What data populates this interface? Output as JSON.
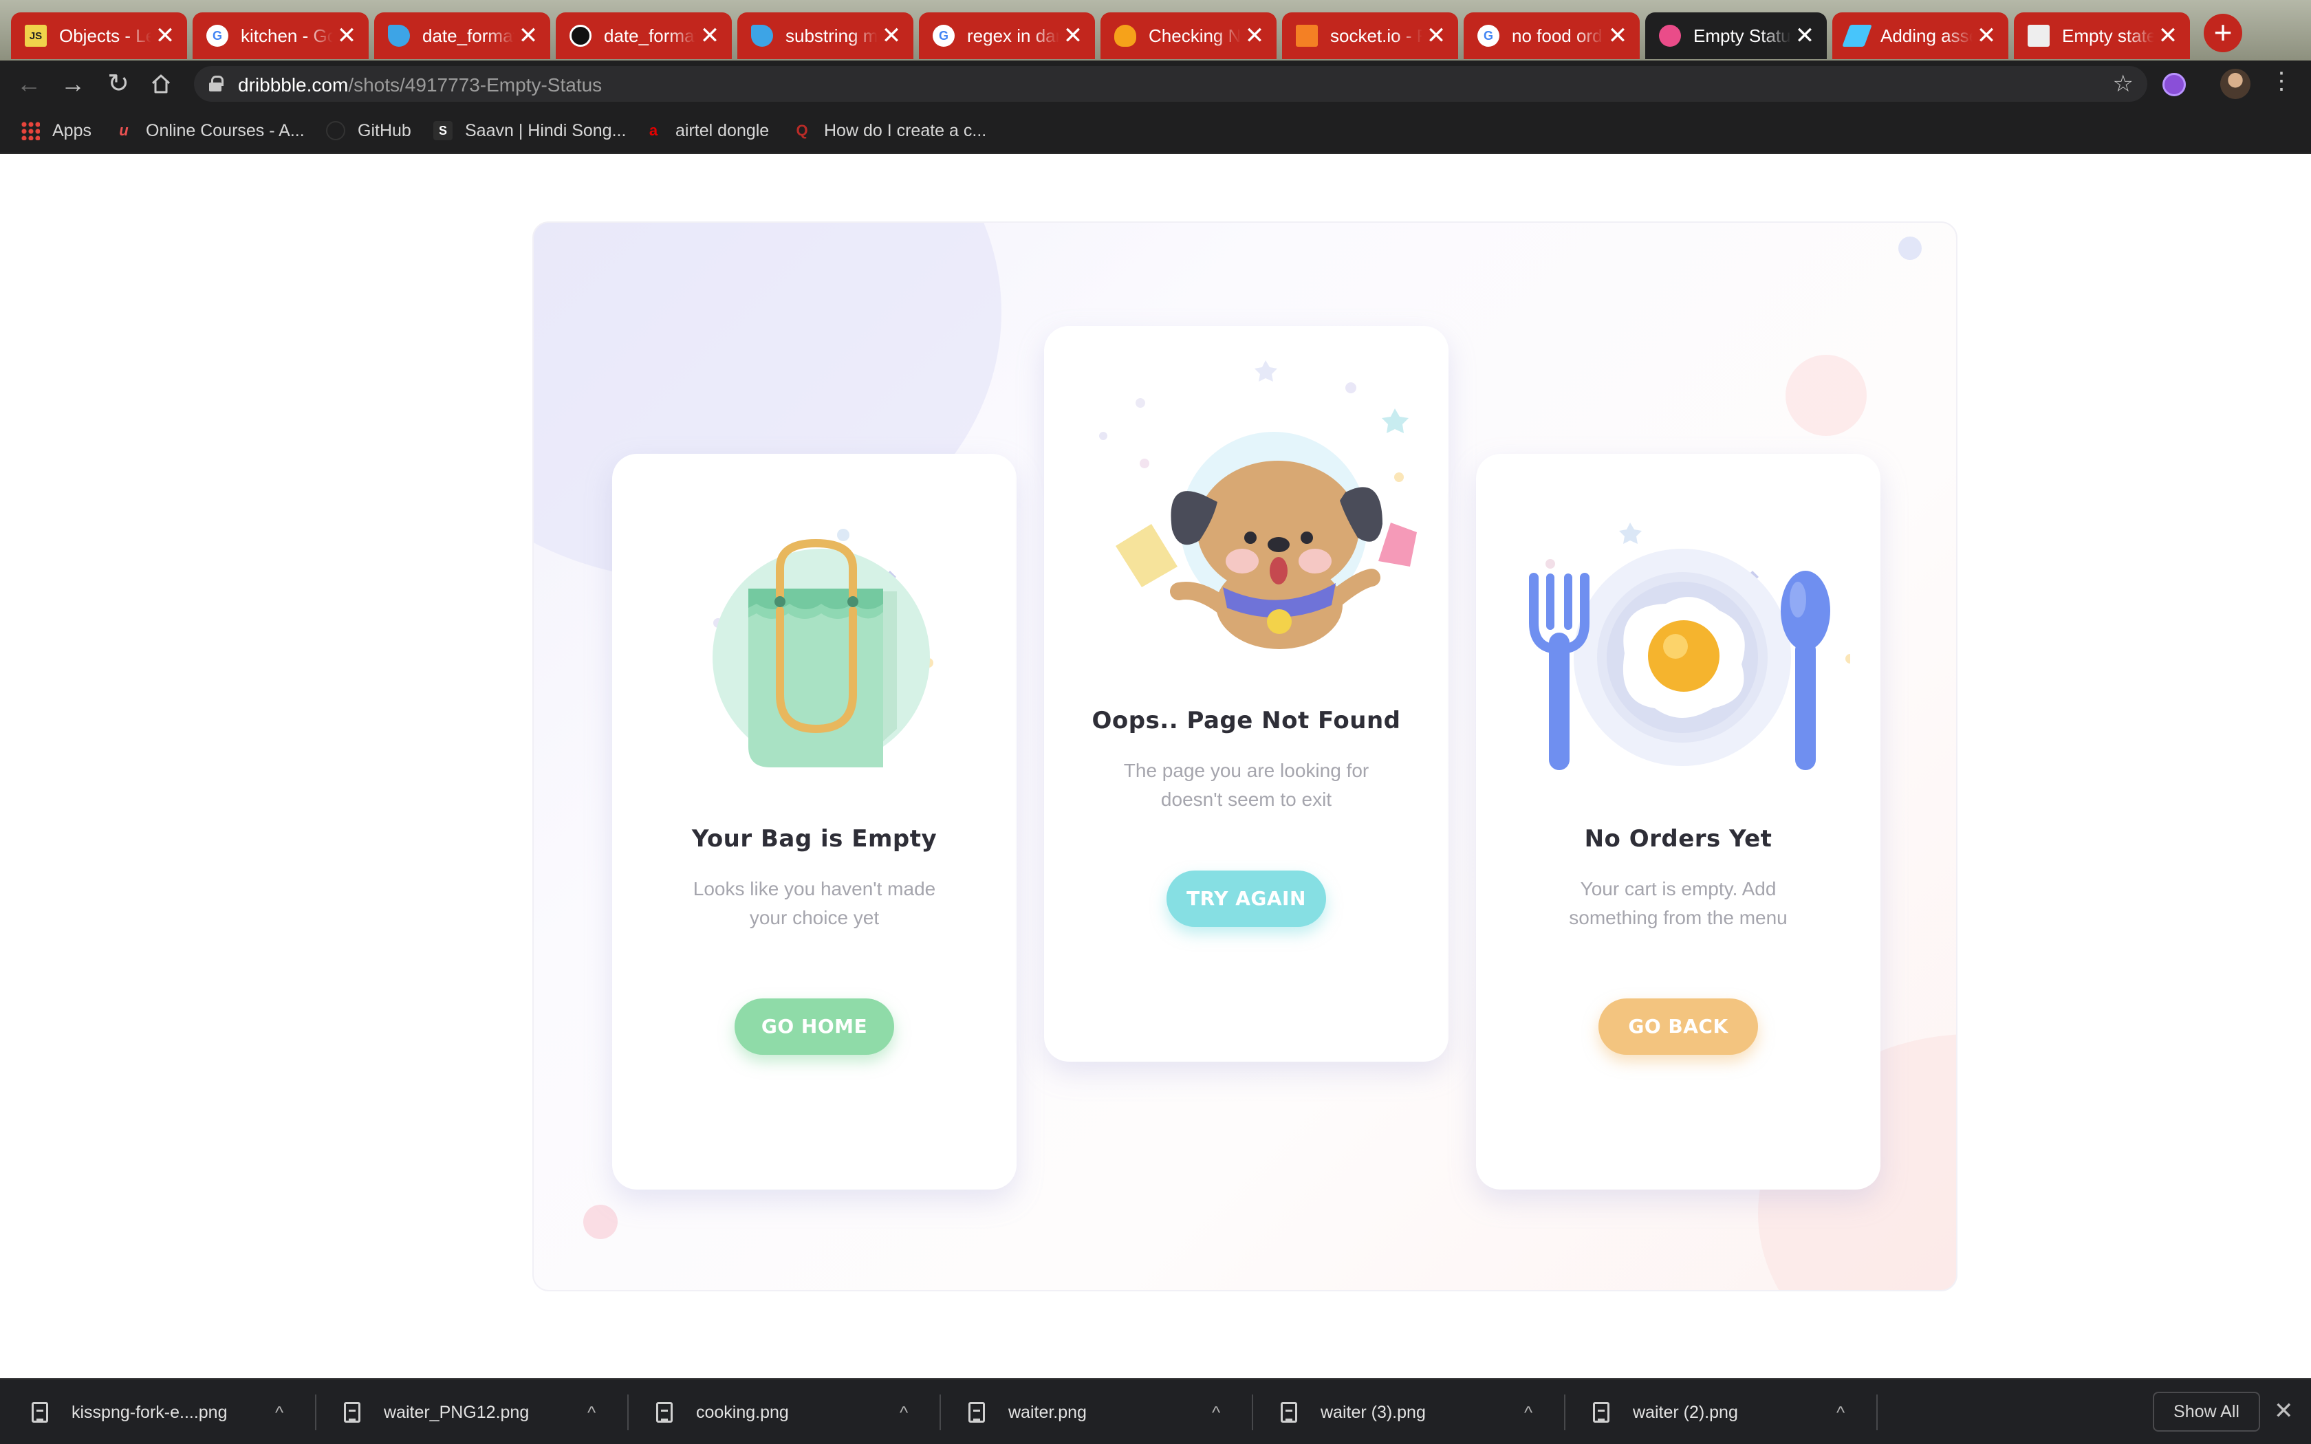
{
  "browser": {
    "tabs": [
      {
        "title": "Objects - Le",
        "favicon": "js-icon",
        "favicon_bg": "#f0d34b",
        "favicon_text": "JS"
      },
      {
        "title": "kitchen - Go",
        "favicon": "google-icon",
        "favicon_bg": "#ffffff",
        "favicon_text": "G"
      },
      {
        "title": "date_format",
        "favicon": "dart-icon",
        "favicon_bg": "#3da4e6",
        "favicon_text": ""
      },
      {
        "title": "date_format",
        "favicon": "github-icon",
        "favicon_bg": "#111111",
        "favicon_text": ""
      },
      {
        "title": "substring m",
        "favicon": "dart-icon",
        "favicon_bg": "#3da4e6",
        "favicon_text": ""
      },
      {
        "title": "regex in dar",
        "favicon": "google-icon",
        "favicon_bg": "#ffffff",
        "favicon_text": "G"
      },
      {
        "title": "Checking N",
        "favicon": "firebase-icon",
        "favicon_bg": "#f6a21a",
        "favicon_text": ""
      },
      {
        "title": "socket.io - F",
        "favicon": "stackoverflow-icon",
        "favicon_bg": "#f48024",
        "favicon_text": ""
      },
      {
        "title": "no food ord",
        "favicon": "google-icon",
        "favicon_bg": "#ffffff",
        "favicon_text": "G"
      },
      {
        "title": "Empty Statu",
        "favicon": "dribbble-icon",
        "favicon_bg": "#ea4c89",
        "favicon_text": "",
        "active": true
      },
      {
        "title": "Adding asse",
        "favicon": "flutter-icon",
        "favicon_bg": "#47c5fb",
        "favicon_text": ""
      },
      {
        "title": "Empty state",
        "favicon": "page-icon",
        "favicon_bg": "#eeeeee",
        "favicon_text": ""
      }
    ],
    "close_glyph": "✕",
    "new_tab_glyph": "+",
    "url_host": "dribbble.com",
    "url_path": "/shots/4917773-Empty-Status",
    "bookmarks": [
      {
        "label": "Apps",
        "icon": "apps-grid-icon"
      },
      {
        "label": "Online Courses - A...",
        "icon": "udemy-icon"
      },
      {
        "label": "GitHub",
        "icon": "github-icon"
      },
      {
        "label": "Saavn | Hindi Song...",
        "icon": "saavn-icon"
      },
      {
        "label": "airtel dongle",
        "icon": "airtel-icon"
      },
      {
        "label": "How do I create a c...",
        "icon": "quora-icon"
      }
    ]
  },
  "shot": {
    "cards": [
      {
        "title": "Your Bag is Empty",
        "line1": "Looks like you haven't made",
        "line2": "your choice yet",
        "button": "GO HOME",
        "button_color": "#8fdba8",
        "illustration": "shopping-bag-icon"
      },
      {
        "title": "Oops.. Page Not Found",
        "line1": "The page you are looking for",
        "line2": "doesn't seem to exit",
        "button": "TRY AGAIN",
        "button_color": "#86dfe3",
        "illustration": "puppy-icon"
      },
      {
        "title": "No Orders Yet",
        "line1": "Your cart is empty. Add",
        "line2": "something from the menu",
        "button": "GO BACK",
        "button_color": "#f3c47f",
        "illustration": "plate-with-egg-icon"
      }
    ]
  },
  "downloads": {
    "files": [
      "kisspng-fork-e....png",
      "waiter_PNG12.png",
      "cooking.png",
      "waiter.png",
      "waiter (3).png",
      "waiter (2).png"
    ],
    "show_all": "Show All",
    "close_glyph": "✕",
    "chevron_glyph": "^"
  }
}
